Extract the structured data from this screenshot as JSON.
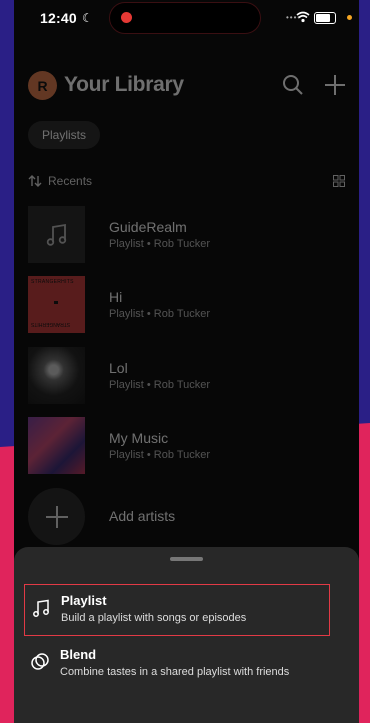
{
  "status_bar": {
    "time": "12:40"
  },
  "library": {
    "avatar_initial": "R",
    "title": "Your Library",
    "chip": "Playlists",
    "sort_label": "Recents",
    "items": [
      {
        "title": "GuideRealm",
        "subtitle": "Playlist • Rob Tucker",
        "thumb": "music-note-icon"
      },
      {
        "title": "Hi",
        "subtitle": "Playlist • Rob Tucker",
        "thumb_text_top": "STRANGERHITS",
        "thumb_text_bottom": "STRANGERHITS"
      },
      {
        "title": "Lol",
        "subtitle": "Playlist • Rob Tucker",
        "thumb": "portrait-cover"
      },
      {
        "title": "My Music",
        "subtitle": "Playlist • Rob Tucker",
        "thumb": "abstract-cover"
      }
    ],
    "add_artists": "Add artists"
  },
  "sheet": {
    "options": [
      {
        "title": "Playlist",
        "subtitle": "Build a playlist with songs or episodes",
        "icon": "music-note-icon"
      },
      {
        "title": "Blend",
        "subtitle": "Combine tastes in a shared playlist with friends",
        "icon": "blend-icon"
      }
    ]
  },
  "colors": {
    "highlight": "#e23a46",
    "pink_bg": "#e0245c",
    "navy_bg": "#2a1f86"
  }
}
